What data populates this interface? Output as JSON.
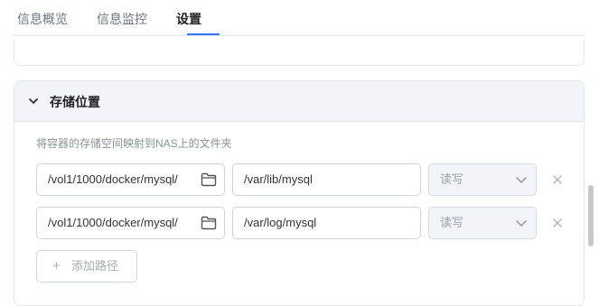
{
  "tabs": [
    {
      "label": "信息概览",
      "active": false
    },
    {
      "label": "信息监控",
      "active": false
    },
    {
      "label": "设置",
      "active": true
    }
  ],
  "section": {
    "title": "存储位置",
    "description": "将容器的存储空间映射到NAS上的文件夹",
    "rows": [
      {
        "host_path": "/vol1/1000/docker/mysql/",
        "container_path": "/var/lib/mysql",
        "permission": "读写"
      },
      {
        "host_path": "/vol1/1000/docker/mysql/",
        "container_path": "/var/log/mysql",
        "permission": "读写"
      }
    ],
    "add_label": "添加路径"
  },
  "icons": {
    "section_toggle": "chevron-down-icon",
    "folder": "folder-icon",
    "remove": "close-icon",
    "select_arrow": "chevron-down-icon",
    "add": "plus-icon"
  },
  "colors": {
    "accent": "#2f7cf6",
    "header_bg": "#f1f4f8"
  }
}
